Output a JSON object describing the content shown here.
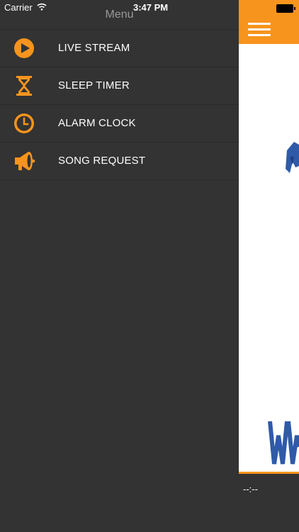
{
  "status_bar": {
    "carrier": "Carrier",
    "time": "3:47 PM"
  },
  "menu": {
    "title": "Menu",
    "items": [
      {
        "label": "LIVE STREAM",
        "icon": "play-circle-icon"
      },
      {
        "label": "SLEEP TIMER",
        "icon": "hourglass-icon"
      },
      {
        "label": "ALARM CLOCK",
        "icon": "clock-icon"
      },
      {
        "label": "SONG REQUEST",
        "icon": "megaphone-icon"
      }
    ]
  },
  "player": {
    "time_display": "--:--"
  },
  "colors": {
    "accent": "#f7941d",
    "background": "#333333",
    "logo_blue": "#2f5aa8"
  }
}
